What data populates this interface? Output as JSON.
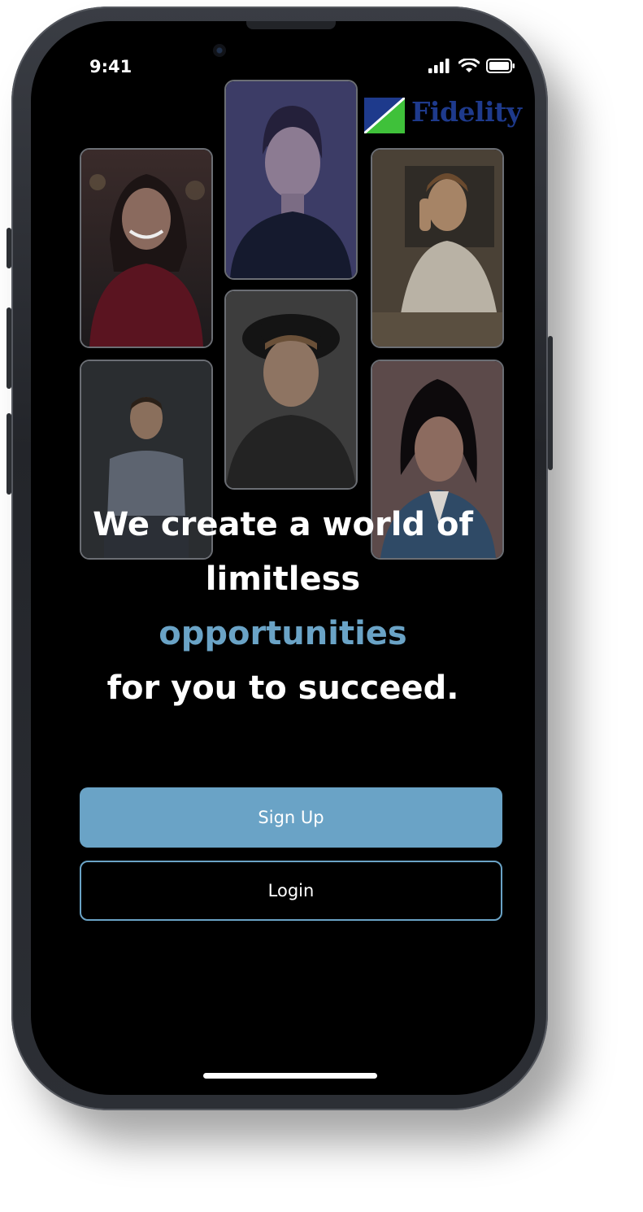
{
  "status_bar": {
    "time": "9:41",
    "signal_icon": "signal-icon",
    "wifi_icon": "wifi-icon",
    "battery_icon": "battery-icon"
  },
  "brand": {
    "name": "Fidelity",
    "logo_icon": "fidelity-logo-icon",
    "colors": {
      "navy": "#1e3a8c",
      "green": "#3fc13a"
    }
  },
  "gallery": [
    {
      "name": "photo-woman-red-sweater"
    },
    {
      "name": "photo-woman-dark-top"
    },
    {
      "name": "photo-man-phone-call"
    },
    {
      "name": "photo-man-gray-shirt"
    },
    {
      "name": "photo-man-hat"
    },
    {
      "name": "photo-woman-denim-jacket"
    }
  ],
  "headline": {
    "line1": "We create a world of",
    "line2": "limitless",
    "line3": "opportunities",
    "line4": "for you to succeed."
  },
  "actions": {
    "signup_label": "Sign Up",
    "login_label": "Login"
  },
  "colors": {
    "accent": "#6aa3c6",
    "background": "#000000",
    "text": "#ffffff"
  }
}
